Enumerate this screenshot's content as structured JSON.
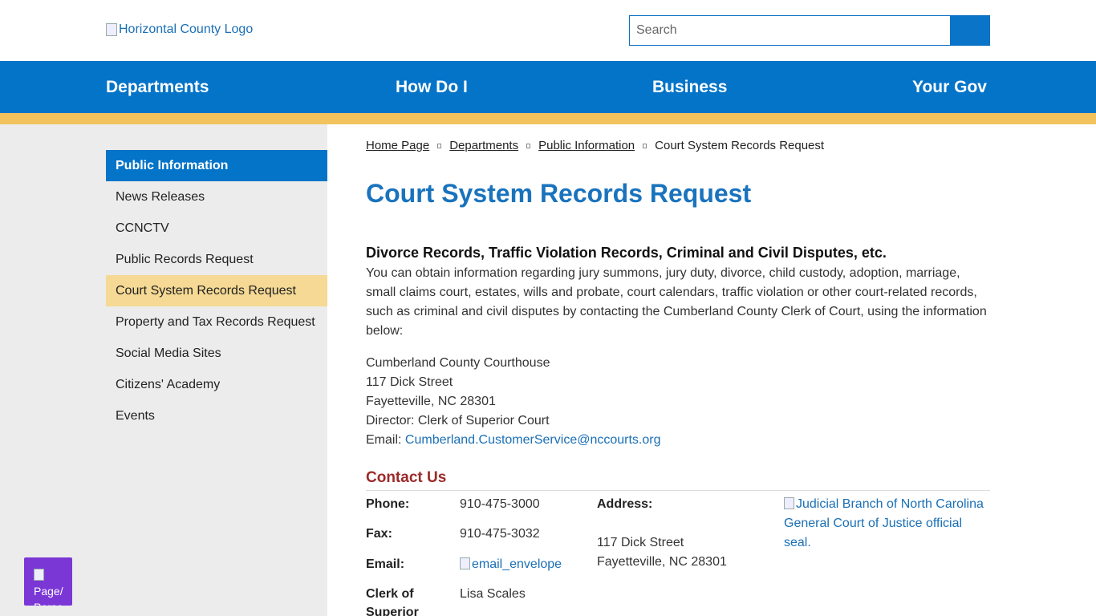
{
  "header": {
    "logo_alt": "Horizontal County Logo",
    "search_placeholder": "Search"
  },
  "nav": {
    "items": [
      "Departments",
      "How Do I",
      "Business",
      "Your Gov"
    ]
  },
  "sidebar": {
    "title": "Public Information",
    "items": [
      "News Releases",
      "CCNCTV",
      "Public Records Request",
      "Court System Records Request",
      "Property and Tax Records Request",
      "Social Media Sites",
      "Citizens' Academy",
      "Events"
    ],
    "active_index": 3
  },
  "breadcrumb": {
    "items": [
      "Home Page",
      "Departments",
      "Public Information"
    ],
    "current": "Court System Records Request"
  },
  "main": {
    "title": "Court System Records Request",
    "subheading": "Divorce Records, Traffic Violation Records, Criminal and Civil Disputes, etc.",
    "intro": "You can obtain information regarding jury summons, jury duty, divorce, child custody, adoption, marriage, small claims court, estates, wills and probate, court calendars, traffic violation or other court-related records, such as criminal and civil disputes by contacting the Cumberland County Clerk of Court, using the information below:",
    "address_lines": [
      "Cumberland County Courthouse",
      "117 Dick Street",
      "Fayetteville, NC 28301",
      "Director: Clerk of Superior Court"
    ],
    "email_label": "Email: ",
    "email": "Cumberland.CustomerService@nccourts.org"
  },
  "contact": {
    "title": "Contact Us",
    "phone_label": "Phone:",
    "phone": "910-475-3000",
    "fax_label": "Fax:",
    "fax": "910-475-3032",
    "email_label": "Email:",
    "email_img_alt": "email_envelope",
    "clerk_label": "Clerk of Superior",
    "clerk": "Lisa Scales",
    "address_label": "Address:",
    "address_line1": "117 Dick Street",
    "address_line2": "Fayetteville, NC 28301",
    "seal_alt": "Judicial Branch of North Carolina General Court of Justice official seal."
  },
  "widget": {
    "label": "Page/ Perso"
  }
}
